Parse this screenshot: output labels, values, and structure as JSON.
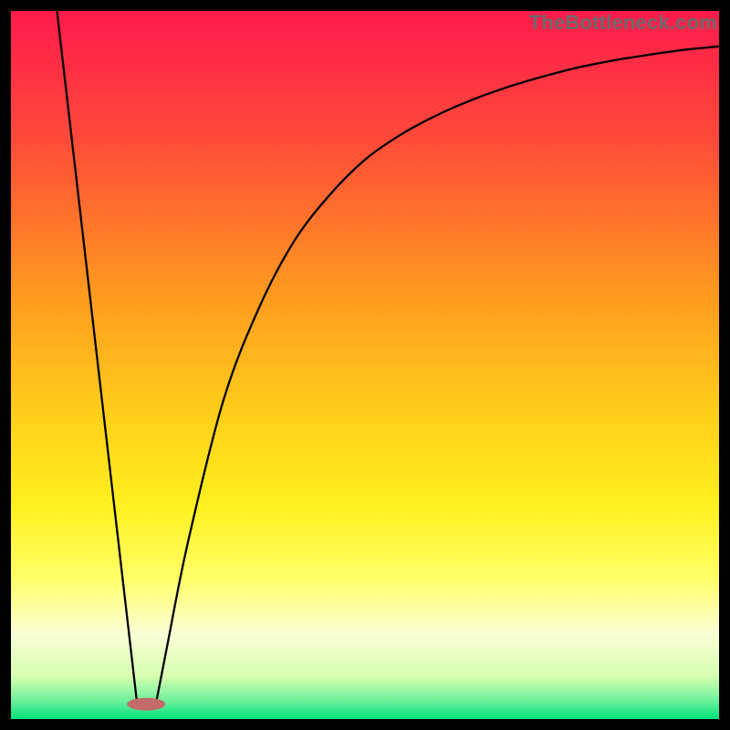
{
  "watermark": "TheBottleneck.com",
  "chart_data": {
    "type": "line",
    "title": "",
    "xlabel": "",
    "ylabel": "",
    "xlim": [
      0,
      100
    ],
    "ylim": [
      0,
      100
    ],
    "grid": false,
    "legend": false,
    "background_gradient_stops": [
      {
        "offset": 0.0,
        "color": "#ff1a4b"
      },
      {
        "offset": 0.18,
        "color": "#ff4a3a"
      },
      {
        "offset": 0.4,
        "color": "#ff9a1f"
      },
      {
        "offset": 0.58,
        "color": "#ffd21a"
      },
      {
        "offset": 0.7,
        "color": "#fff01f"
      },
      {
        "offset": 0.8,
        "color": "#ffff66"
      },
      {
        "offset": 0.88,
        "color": "#fbffd6"
      },
      {
        "offset": 0.94,
        "color": "#d6ffb0"
      },
      {
        "offset": 0.975,
        "color": "#69f09a"
      },
      {
        "offset": 1.0,
        "color": "#00e27a"
      }
    ],
    "series": [
      {
        "name": "left-branch",
        "type": "segment",
        "points": [
          {
            "x": 6.5,
            "y": 100
          },
          {
            "x": 17.8,
            "y": 2.3
          }
        ]
      },
      {
        "name": "right-branch",
        "type": "curve",
        "points": [
          {
            "x": 20.5,
            "y": 2.3
          },
          {
            "x": 22,
            "y": 10
          },
          {
            "x": 25,
            "y": 25
          },
          {
            "x": 30,
            "y": 45
          },
          {
            "x": 35,
            "y": 58
          },
          {
            "x": 40,
            "y": 67.5
          },
          {
            "x": 45,
            "y": 74
          },
          {
            "x": 50,
            "y": 79
          },
          {
            "x": 55,
            "y": 82.5
          },
          {
            "x": 60,
            "y": 85.2
          },
          {
            "x": 65,
            "y": 87.4
          },
          {
            "x": 70,
            "y": 89.2
          },
          {
            "x": 75,
            "y": 90.7
          },
          {
            "x": 80,
            "y": 92
          },
          {
            "x": 85,
            "y": 93
          },
          {
            "x": 90,
            "y": 93.8
          },
          {
            "x": 95,
            "y": 94.5
          },
          {
            "x": 100,
            "y": 95
          }
        ]
      }
    ],
    "marker": {
      "name": "bottleneck-marker",
      "cx": 19.1,
      "cy": 2.1,
      "rx": 2.7,
      "ry": 0.9,
      "fill": "#c46a6a"
    }
  }
}
